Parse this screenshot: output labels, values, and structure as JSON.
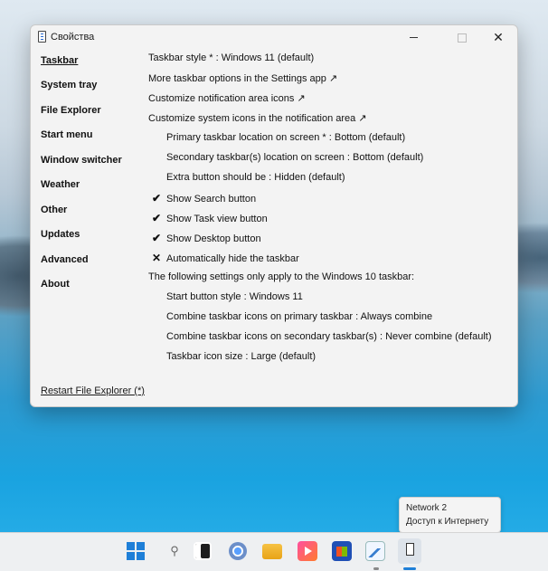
{
  "window": {
    "title": "Свойства",
    "close_glyph": "✕"
  },
  "sidebar": {
    "items": [
      {
        "label": "Taskbar",
        "active": true
      },
      {
        "label": "System tray"
      },
      {
        "label": "File Explorer"
      },
      {
        "label": "Start menu"
      },
      {
        "label": "Window switcher"
      },
      {
        "label": "Weather"
      },
      {
        "label": "Other"
      },
      {
        "label": "Updates"
      },
      {
        "label": "Advanced"
      },
      {
        "label": "About"
      }
    ],
    "restart_link": "Restart File Explorer (*)"
  },
  "settings": {
    "rows": [
      {
        "text": "Taskbar style * : Windows 11 (default)"
      },
      {
        "text": "More taskbar options in the Settings app ↗"
      },
      {
        "text": "Customize notification area icons ↗"
      },
      {
        "text": "Customize system icons in the notification area ↗"
      },
      {
        "text": "Primary taskbar location on screen * : Bottom (default)"
      },
      {
        "text": "Secondary taskbar(s) location on screen : Bottom (default)"
      },
      {
        "text": "Extra button should be : Hidden (default)"
      },
      {
        "text": "Show Search button",
        "mark": "✔"
      },
      {
        "text": "Show Task view button",
        "mark": "✔"
      },
      {
        "text": "Show Desktop button",
        "mark": "✔"
      },
      {
        "text": "Automatically hide the taskbar",
        "mark": "✕"
      },
      {
        "text": "The following settings only apply to the Windows 10 taskbar:"
      },
      {
        "text": "Start button style : Windows 11"
      },
      {
        "text": "Combine taskbar icons on primary taskbar : Always combine"
      },
      {
        "text": "Combine taskbar icons on secondary taskbar(s) : Never combine (default)"
      },
      {
        "text": "Taskbar icon size : Large (default)"
      }
    ]
  },
  "tooltip": {
    "line1": "Network 2",
    "line2": "Доступ к Интернету"
  },
  "taskbar": {
    "search_glyph": "⚲",
    "icons": [
      "start-icon",
      "search-icon",
      "task-view-icon",
      "chrome-icon",
      "file-explorer-icon",
      "media-player-icon",
      "store-icon",
      "resource-monitor-icon",
      "properties-app-icon"
    ]
  }
}
